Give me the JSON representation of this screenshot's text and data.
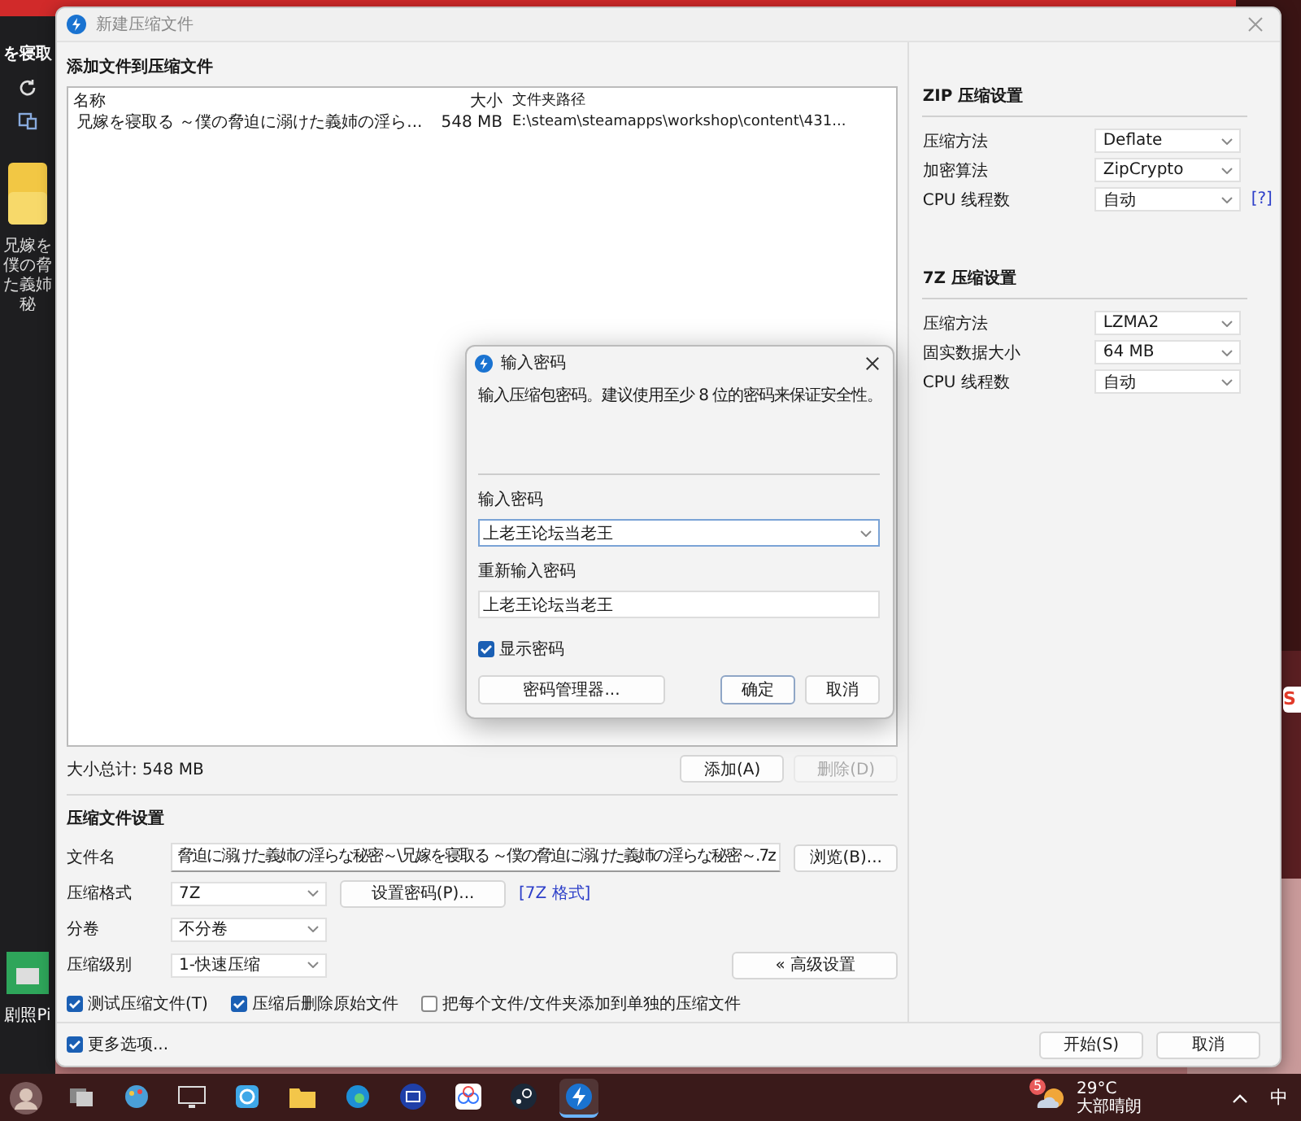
{
  "background_window": {
    "title_fragment": "を寝取",
    "caption_lines": [
      "兄嫁を",
      "僕の脅",
      "た義姉",
      "秘"
    ],
    "shortcut_label": "剧照Pi"
  },
  "window": {
    "title": "新建压缩文件"
  },
  "files": {
    "heading": "添加文件到压缩文件",
    "columns": [
      "名称",
      "大小",
      "文件夹路径"
    ],
    "rows": [
      {
        "name": "兄嫁を寝取る ～僕の脅迫に溺けた義姉の淫ら...",
        "size": "548 MB",
        "path": "E:\\steam\\steamapps\\workshop\\content\\431..."
      }
    ],
    "total": "大小总计: 548 MB",
    "buttons": [
      {
        "label": "添加(A)",
        "disabled": false
      },
      {
        "label": "删除(D)",
        "disabled": true
      }
    ]
  },
  "archive_settings": {
    "heading": "压缩文件设置",
    "fields": [
      {
        "kind": "text",
        "label": "文件名",
        "value": "脅迫に溺けた義姉の淫らな秘密～\\兄嫁を寝取る ～僕の脅迫に溺けた義姉の淫らな秘密～.7z",
        "button": "浏览(B)..."
      },
      {
        "kind": "select",
        "label": "压缩格式",
        "value": "7Z",
        "button": "设置密码(P)...",
        "link": "[7Z 格式]"
      },
      {
        "kind": "select",
        "label": "分卷",
        "value": "不分卷"
      },
      {
        "kind": "select",
        "label": "压缩级别",
        "value": "1-快速压缩",
        "button": "« 高级设置"
      }
    ],
    "options": [
      {
        "label": "测试压缩文件(T)",
        "checked": true
      },
      {
        "label": "压缩后删除原始文件",
        "checked": true
      },
      {
        "label": "把每个文件/文件夹添加到单独的压缩文件",
        "checked": false
      }
    ]
  },
  "more_options": {
    "label": "更多选项...",
    "checked": true
  },
  "footer_buttons": [
    "开始(S)",
    "取消"
  ],
  "zip": {
    "heading": "ZIP 压缩设置",
    "rows": [
      {
        "label": "压缩方法",
        "value": "Deflate"
      },
      {
        "label": "加密算法",
        "value": "ZipCrypto"
      },
      {
        "label": "CPU 线程数",
        "value": "自动",
        "help": "[?]"
      }
    ]
  },
  "sevenz": {
    "heading": "7Z 压缩设置",
    "rows": [
      {
        "label": "压缩方法",
        "value": "LZMA2"
      },
      {
        "label": "固实数据大小",
        "value": "64 MB"
      },
      {
        "label": "CPU 线程数",
        "value": "自动"
      }
    ]
  },
  "dialog": {
    "title": "输入密码",
    "message": "输入压缩包密码。建议使用至少 8 位的密码来保证安全性。",
    "password_label": "输入密码",
    "password": "上老王论坛当老王",
    "confirm_label": "重新输入密码",
    "confirm": "上老王论坛当老王",
    "show_password": {
      "label": "显示密码",
      "checked": true
    },
    "buttons": [
      "密码管理器...",
      "确定",
      "取消"
    ]
  },
  "floating_tab": "S",
  "taskbar": {
    "apps": [
      {
        "kind": "taskview",
        "selected": false
      },
      {
        "kind": "paint",
        "selected": false
      },
      {
        "kind": "monitor",
        "selected": false
      },
      {
        "kind": "remote",
        "selected": false
      },
      {
        "kind": "folder",
        "selected": false
      },
      {
        "kind": "browser",
        "selected": false
      },
      {
        "kind": "capture",
        "selected": false
      },
      {
        "kind": "cloud",
        "selected": false
      },
      {
        "kind": "game",
        "selected": false
      },
      {
        "kind": "bolt",
        "selected": true
      }
    ],
    "weather": {
      "badge": "5",
      "temperature": "29°C",
      "condition": "大部晴朗"
    },
    "ime": "中"
  }
}
